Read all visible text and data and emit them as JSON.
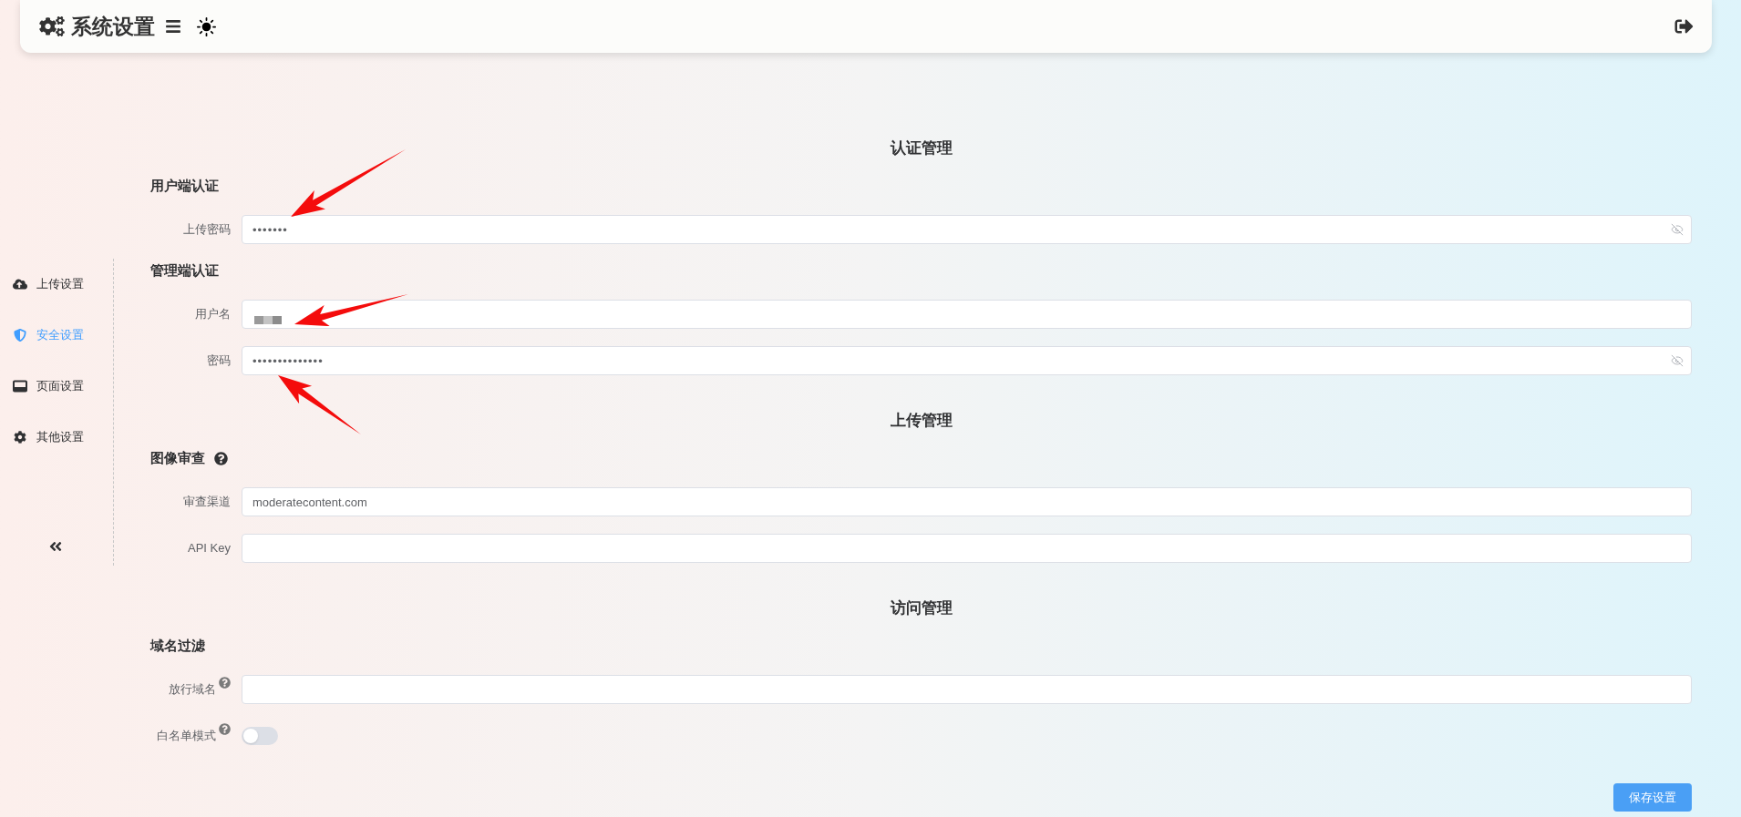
{
  "header": {
    "title": "系统设置"
  },
  "sidebar": {
    "items": [
      {
        "label": "上传设置",
        "selected": false
      },
      {
        "label": "安全设置",
        "selected": true
      },
      {
        "label": "页面设置",
        "selected": false
      },
      {
        "label": "其他设置",
        "selected": false
      }
    ]
  },
  "sections": [
    {
      "title": "认证管理",
      "groups": [
        {
          "title": "用户端认证",
          "help": false,
          "fields": [
            {
              "label": "上传密码",
              "kind": "password",
              "help": false,
              "value": "•••••••"
            }
          ]
        },
        {
          "title": "管理端认证",
          "help": false,
          "fields": [
            {
              "label": "用户名",
              "kind": "text",
              "help": false,
              "redacted": true
            },
            {
              "label": "密码",
              "kind": "password",
              "help": false,
              "value": "••••••••••••••"
            }
          ]
        }
      ]
    },
    {
      "title": "上传管理",
      "groups": [
        {
          "title": "图像审查",
          "help": true,
          "fields": [
            {
              "label": "审查渠道",
              "kind": "text",
              "help": false,
              "value": "moderatecontent.com"
            },
            {
              "label": "API Key",
              "kind": "text",
              "help": false
            }
          ]
        }
      ]
    },
    {
      "title": "访问管理",
      "groups": [
        {
          "title": "域名过滤",
          "help": false,
          "fields": [
            {
              "label": "放行域名",
              "kind": "text",
              "help": true
            },
            {
              "label": "白名单模式",
              "kind": "switch",
              "help": true,
              "on": false
            }
          ]
        }
      ]
    }
  ],
  "save_button": "保存设置"
}
